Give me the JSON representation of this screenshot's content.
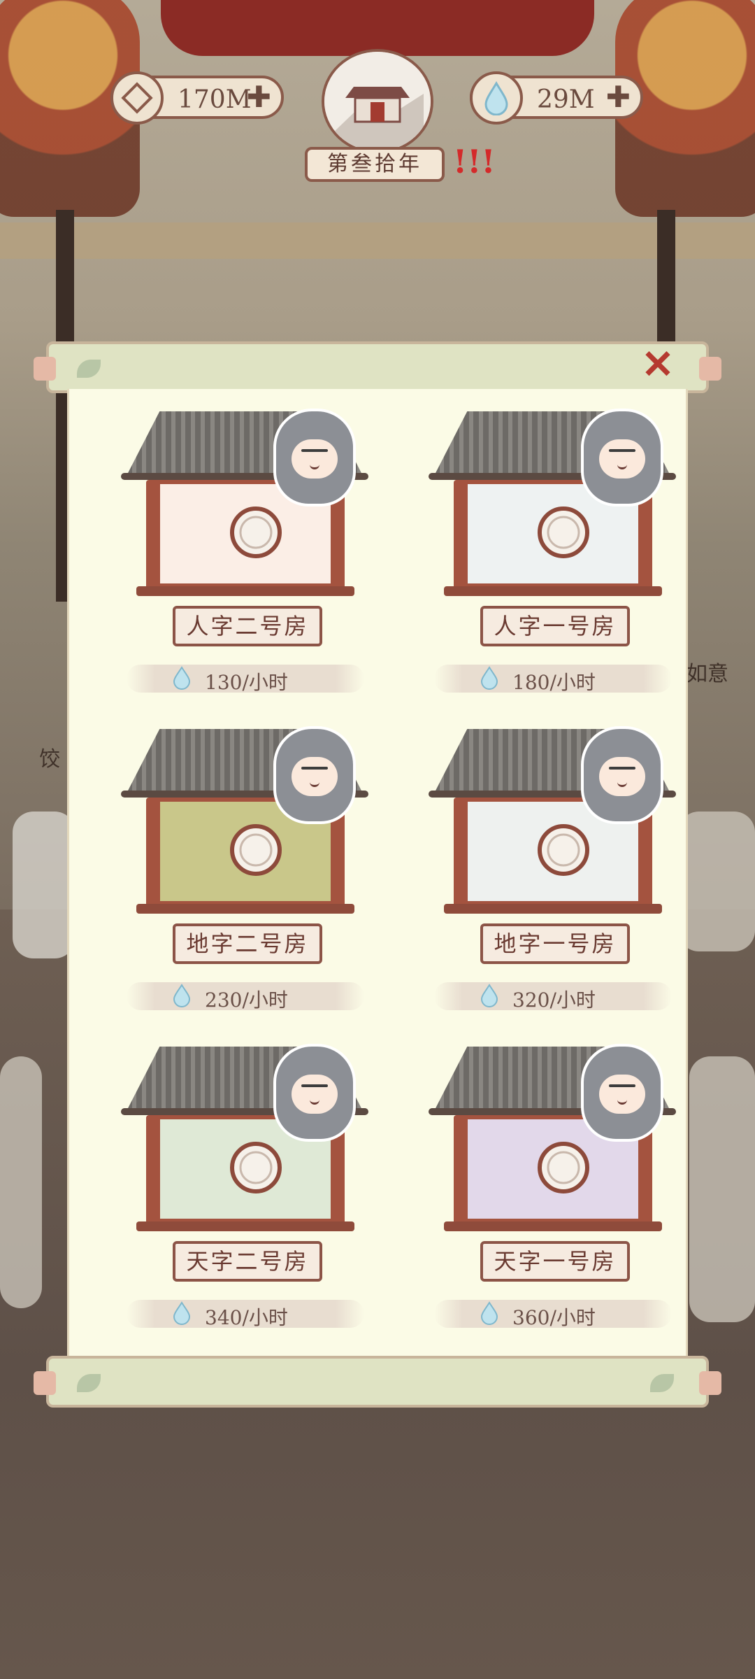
{
  "resources": {
    "coin": {
      "value": "170M",
      "plus": "✚",
      "icon": "coin-icon"
    },
    "spirit": {
      "value": "29M",
      "plus": "✚",
      "icon": "water-drop-icon"
    }
  },
  "year": {
    "label": "第叁拾年",
    "alert": "!!!"
  },
  "background_labels": {
    "right": "如意",
    "left": "饺"
  },
  "panel": {
    "close": "✕",
    "rooms": [
      {
        "name": "人字二号房",
        "rate": "130/小时",
        "wall_color": "#fbeee6"
      },
      {
        "name": "人字一号房",
        "rate": "180/小时",
        "wall_color": "#eef2f2"
      },
      {
        "name": "地字二号房",
        "rate": "230/小时",
        "wall_color": "#c9c78a"
      },
      {
        "name": "地字一号房",
        "rate": "320/小时",
        "wall_color": "#eef1ef"
      },
      {
        "name": "天字二号房",
        "rate": "340/小时",
        "wall_color": "#dfe9d6"
      },
      {
        "name": "天字一号房",
        "rate": "360/小时",
        "wall_color": "#e2d8ea"
      }
    ]
  },
  "colors": {
    "accent": "#8a5a4a",
    "close": "#b5392f",
    "panel": "#fbfbe6"
  }
}
